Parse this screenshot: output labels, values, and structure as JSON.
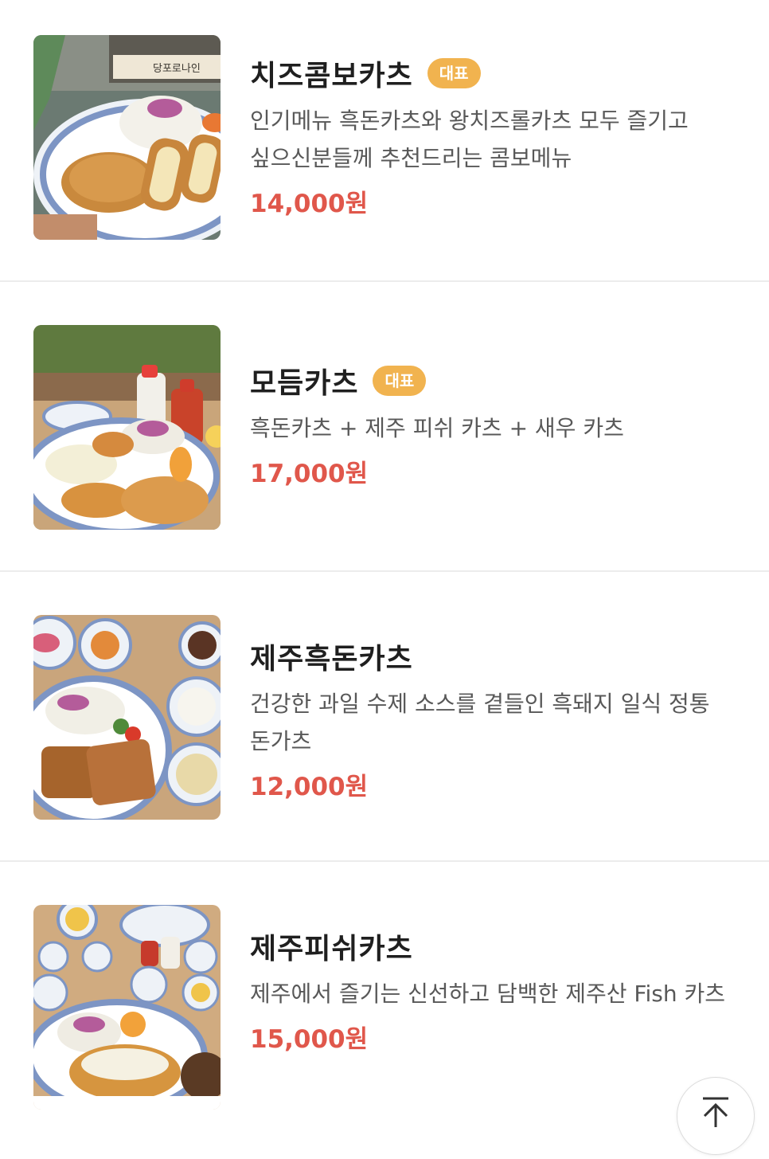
{
  "menu": {
    "items": [
      {
        "name": "치즈콤보카츠",
        "badge": "대표",
        "description": "인기메뉴 흑돈카츠와 왕치즈롤카츠 모두 즐기고 싶으신분들께 추천드리는 콤보메뉴",
        "price": "14,000원",
        "image_sign_text": "당포로나인"
      },
      {
        "name": "모듬카츠",
        "badge": "대표",
        "description": "흑돈카츠 + 제주 피쉬 카츠 + 새우 카츠",
        "price": "17,000원"
      },
      {
        "name": "제주흑돈카츠",
        "badge": "",
        "description": "건강한 과일 수제 소스를 곁들인 흑돼지 일식 정통 돈가츠",
        "price": "12,000원"
      },
      {
        "name": "제주피쉬카츠",
        "badge": "",
        "description": "제주에서 즐기는 신선하고 담백한 제주산 Fish 카츠",
        "price": "15,000원"
      }
    ]
  },
  "colors": {
    "badge_bg": "#f1b34f",
    "price": "#e0574b",
    "title": "#1f1f1f",
    "description": "#585858",
    "divider": "#ececec"
  },
  "icons": {
    "scroll_top": "arrow-up-to-top-icon"
  }
}
